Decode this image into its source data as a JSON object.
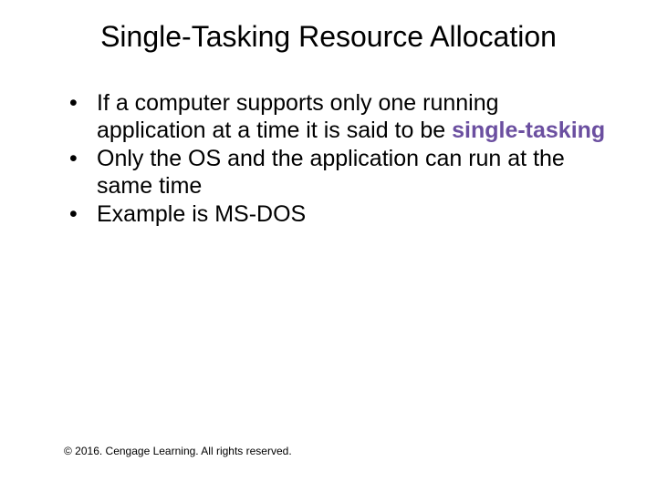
{
  "title": "Single-Tasking Resource Allocation",
  "bullets": {
    "b1_pre": "If a computer supports only one running application at a time it is said to be ",
    "b1_term": "single-tasking",
    "b2": "Only the OS and the application can run at the same time",
    "b3": "Example is MS-DOS"
  },
  "footer": "© 2016. Cengage Learning. All rights reserved."
}
